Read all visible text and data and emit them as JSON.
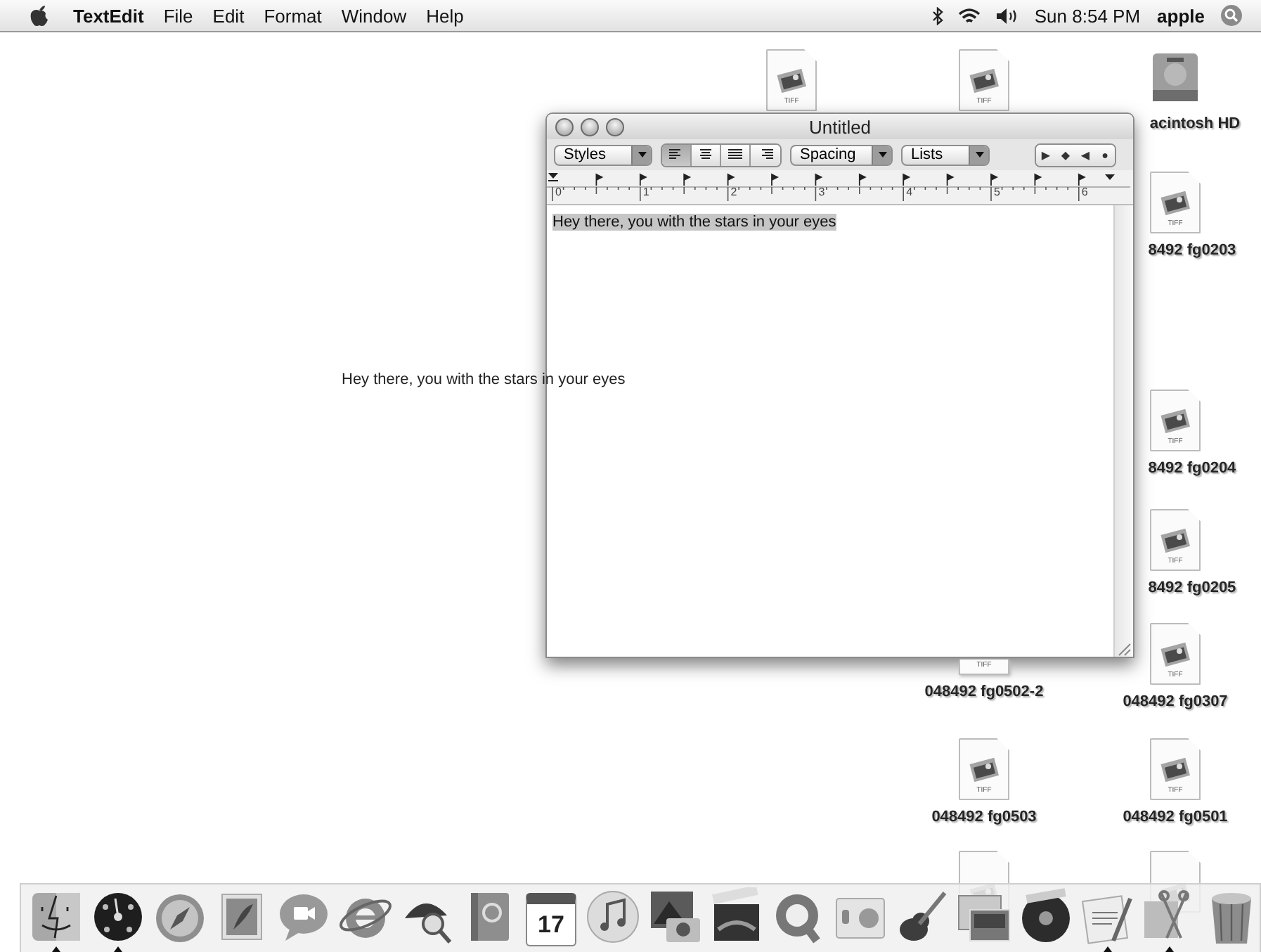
{
  "menu_bar": {
    "app_name": "TextEdit",
    "menus": [
      "File",
      "Edit",
      "Format",
      "Window",
      "Help"
    ],
    "status_icons": [
      {
        "kind": "bluetooth"
      },
      {
        "kind": "wifi"
      },
      {
        "kind": "volume"
      }
    ],
    "clock": "Sun 8:54 PM",
    "user": "apple"
  },
  "desktop_icons": [
    {
      "kind": "tiff",
      "badge": "TIFF"
    },
    {
      "kind": "tiff",
      "badge": "TIFF"
    },
    {
      "kind": "drive",
      "label": "acintosh HD"
    },
    {
      "kind": "tiff",
      "badge": "TIFF",
      "label": "8492 fg0203"
    },
    {
      "kind": "tiff",
      "badge": "TIFF",
      "label": "8492 fg0204"
    },
    {
      "kind": "tiff",
      "badge": "TIFF",
      "label": "8492 fg0205"
    },
    {
      "kind": "tiff_edge",
      "badge": "TIFF",
      "label": "048492 fg0502-2"
    },
    {
      "kind": "tiff",
      "badge": "TIFF",
      "label": "048492 fg0307"
    },
    {
      "kind": "tiff",
      "badge": "TIFF",
      "label": "048492 fg0503"
    },
    {
      "kind": "tiff",
      "badge": "TIFF",
      "label": "048492 fg0501"
    },
    {
      "kind": "tiff"
    },
    {
      "kind": "tiff"
    }
  ],
  "window": {
    "title": "Untitled",
    "toolbar": {
      "styles": "Styles",
      "alignment": [
        {
          "kind": "left",
          "selected": true
        },
        {
          "kind": "center",
          "selected": false
        },
        {
          "kind": "justify",
          "selected": false
        },
        {
          "kind": "right",
          "selected": false
        }
      ],
      "spacing": "Spacing",
      "lists": "Lists",
      "tab_controls": [
        "▶",
        "◆",
        "◀",
        "●"
      ]
    },
    "ruler": {
      "labels": [
        "0",
        "1",
        "2",
        "3",
        "4",
        "5",
        "6"
      ]
    },
    "text": "Hey there, you with the stars in your eyes",
    "text_selected": true
  },
  "dragged_text": "Hey there, you with the stars in your eyes",
  "dock": [
    {
      "kind": "finder",
      "running": true
    },
    {
      "kind": "dashboard",
      "running": true
    },
    {
      "kind": "compass",
      "running": false
    },
    {
      "kind": "stamp",
      "running": false
    },
    {
      "kind": "chat",
      "running": false
    },
    {
      "kind": "browser",
      "running": false
    },
    {
      "kind": "detective",
      "running": false
    },
    {
      "kind": "book",
      "running": false
    },
    {
      "kind": "calendar",
      "running": false,
      "date": "17"
    },
    {
      "kind": "music",
      "running": false
    },
    {
      "kind": "photo",
      "running": false
    },
    {
      "kind": "clapper",
      "running": false
    },
    {
      "kind": "quicktime",
      "running": false
    },
    {
      "kind": "prefs",
      "running": false
    },
    {
      "kind": "guitar",
      "running": false
    },
    {
      "kind": "slides",
      "running": false
    },
    {
      "kind": "disc",
      "running": false
    },
    {
      "kind": "document",
      "running": true
    },
    {
      "kind": "scissors",
      "running": true
    },
    {
      "kind": "trash",
      "running": false
    }
  ]
}
